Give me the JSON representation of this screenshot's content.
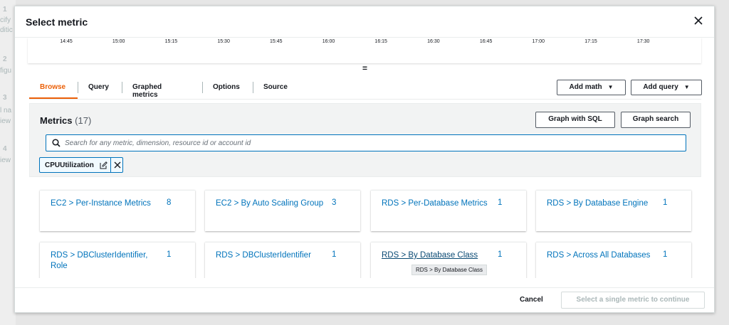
{
  "background_steps": [
    {
      "number": "1",
      "text": "cify"
    },
    {
      "number": "",
      "text": "ditic"
    },
    {
      "number": "2",
      "text": "figu"
    },
    {
      "number": "3",
      "text": "l na"
    },
    {
      "number": "",
      "text": "iew"
    },
    {
      "number": "4",
      "text": "iew"
    }
  ],
  "modal": {
    "title": "Select metric",
    "close_label": "Close"
  },
  "graph": {
    "time_ticks": [
      "14:45",
      "15:00",
      "15:15",
      "15:30",
      "15:45",
      "16:00",
      "16:15",
      "16:30",
      "16:45",
      "17:00",
      "17:15",
      "17:30"
    ],
    "resize_handle": "="
  },
  "tabs": [
    {
      "label": "Browse",
      "active": true
    },
    {
      "label": "Query",
      "active": false
    },
    {
      "label": "Graphed metrics",
      "active": false
    },
    {
      "label": "Options",
      "active": false
    },
    {
      "label": "Source",
      "active": false
    }
  ],
  "actions": {
    "add_math": "Add math",
    "add_query": "Add query"
  },
  "metrics_panel": {
    "title": "Metrics",
    "count": "(17)",
    "graph_with_sql": "Graph with SQL",
    "graph_search": "Graph search",
    "search_placeholder": "Search for any metric, dimension, resource id or account id",
    "search_value": "",
    "filter_token": "CPUUtilization"
  },
  "namespaces": [
    {
      "label": "EC2 > Per-Instance Metrics",
      "count": "8"
    },
    {
      "label": "EC2 > By Auto Scaling Group",
      "count": "3"
    },
    {
      "label": "RDS > Per-Database Metrics",
      "count": "1"
    },
    {
      "label": "RDS > By Database Engine",
      "count": "1"
    },
    {
      "label": "RDS > DBClusterIdentifier, Role",
      "count": "1"
    },
    {
      "label": "RDS > DBClusterIdentifier",
      "count": "1"
    },
    {
      "label": "RDS > By Database Class",
      "count": "1"
    },
    {
      "label": "RDS > Across All Databases",
      "count": "1"
    }
  ],
  "tooltip": "RDS > By Database Class",
  "footer": {
    "cancel": "Cancel",
    "continue": "Select a single metric to continue"
  },
  "colors": {
    "accent_orange": "#eb5f07",
    "link_blue": "#0073bb",
    "disabled_text": "#aab7b8"
  }
}
